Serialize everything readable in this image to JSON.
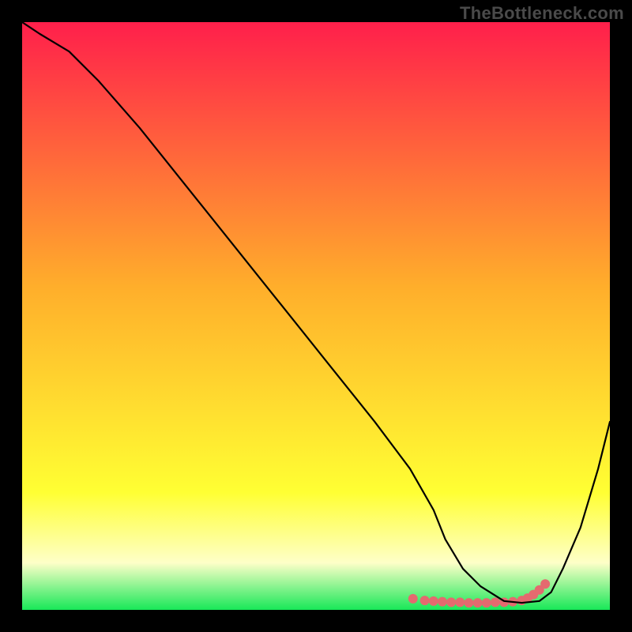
{
  "watermark": {
    "text": "TheBottleneck.com"
  },
  "colors": {
    "gradient_top": "#ff1f4b",
    "gradient_mid": "#ffae2b",
    "gradient_yellow": "#ffff33",
    "gradient_pale": "#feffc8",
    "gradient_green": "#18e858",
    "line": "#000000",
    "highlight": "#e46a6f",
    "background": "#000000"
  },
  "chart_data": {
    "type": "line",
    "title": "",
    "xlabel": "",
    "ylabel": "",
    "xlim": [
      0,
      100
    ],
    "ylim": [
      0,
      100
    ],
    "grid": false,
    "legend": false,
    "series": [
      {
        "name": "bottleneck-curve",
        "x": [
          0,
          3,
          8,
          13,
          20,
          28,
          36,
          44,
          52,
          60,
          66,
          70,
          72,
          75,
          78,
          82,
          85,
          88,
          90,
          92,
          95,
          98,
          100
        ],
        "y": [
          100,
          98,
          95,
          90,
          82,
          72,
          62,
          52,
          42,
          32,
          24,
          17,
          12,
          7,
          4,
          1.5,
          1.2,
          1.5,
          3,
          7,
          14,
          24,
          32
        ]
      }
    ],
    "highlight_marks": {
      "x": [
        66.5,
        68.5,
        70,
        71.5,
        73,
        74.5,
        76,
        77.5,
        79,
        80.5,
        82,
        83.5,
        85,
        86,
        87,
        88,
        89
      ],
      "y": [
        1.9,
        1.6,
        1.5,
        1.4,
        1.3,
        1.3,
        1.2,
        1.2,
        1.2,
        1.3,
        1.3,
        1.4,
        1.6,
        2.0,
        2.6,
        3.4,
        4.4
      ]
    }
  }
}
